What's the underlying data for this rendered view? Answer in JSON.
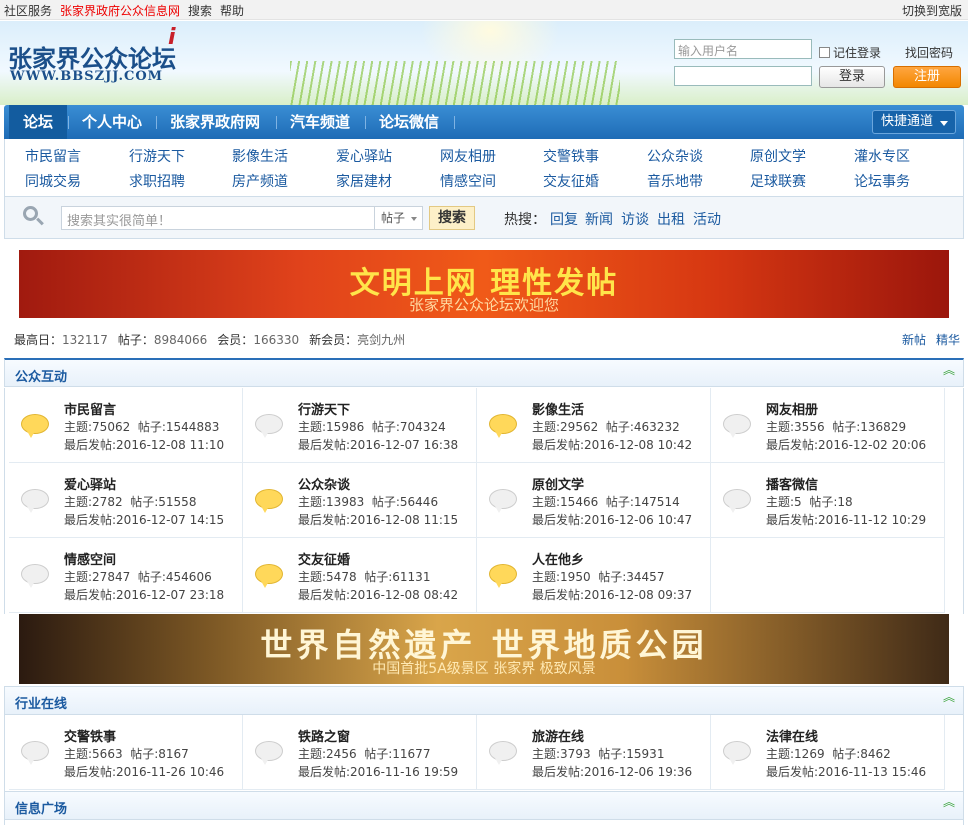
{
  "topbar": {
    "links": [
      "社区服务",
      "张家界政府公众信息网",
      "搜索",
      "帮助"
    ],
    "wide_toggle": "切换到宽版"
  },
  "header": {
    "logo_cn": "张家界公众论坛",
    "logo_en": "WWW.BBSZJJ.COM",
    "username_placeholder": "输入用户名",
    "remember_label": "记住登录",
    "recover_label": "找回密码",
    "login_label": "登录",
    "register_label": "注册"
  },
  "nav": {
    "items": [
      "论坛",
      "个人中心",
      "张家界政府网",
      "汽车频道",
      "论坛微信"
    ],
    "quick_label": "快捷通道"
  },
  "subnav": {
    "row1": [
      "市民留言",
      "行游天下",
      "影像生活",
      "爱心驿站",
      "网友相册",
      "交警铁事",
      "公众杂谈",
      "原创文学",
      "灌水专区"
    ],
    "row2": [
      "同城交易",
      "求职招聘",
      "房产频道",
      "家居建材",
      "情感空间",
      "交友征婚",
      "音乐地带",
      "足球联赛",
      "论坛事务"
    ]
  },
  "search": {
    "placeholder": "搜索其实很简单！",
    "type_label": "帖子",
    "button_label": "搜索",
    "hot_label": "热搜：",
    "hot_words": [
      "回复",
      "新闻",
      "访谈",
      "出租",
      "活动"
    ]
  },
  "banner1": {
    "title": "文明上网 理性发帖",
    "subtitle": "张家界公众论坛欢迎您"
  },
  "stats": {
    "peak_label": "最高日：",
    "peak_value": "132117",
    "posts_label": "帖子：",
    "posts_value": "8984066",
    "members_label": "会员：",
    "members_value": "166330",
    "newmember_label": "新会员：",
    "newmember_value": "亮剑九州",
    "new_posts": "新帖",
    "digest": "精华"
  },
  "sections": [
    {
      "title": "公众互动",
      "forums": [
        {
          "name": "市民留言",
          "topics": "主题:75062",
          "posts": "帖子:1544883",
          "last": "最后发帖:2016-12-08 11:10",
          "new": true
        },
        {
          "name": "行游天下",
          "topics": "主题:15986",
          "posts": "帖子:704324",
          "last": "最后发帖:2016-12-07 16:38",
          "new": false
        },
        {
          "name": "影像生活",
          "topics": "主题:29562",
          "posts": "帖子:463232",
          "last": "最后发帖:2016-12-08 10:42",
          "new": true
        },
        {
          "name": "网友相册",
          "topics": "主题:3556",
          "posts": "帖子:136829",
          "last": "最后发帖:2016-12-02 20:06",
          "new": false
        },
        {
          "name": "爱心驿站",
          "topics": "主题:2782",
          "posts": "帖子:51558",
          "last": "最后发帖:2016-12-07 14:15",
          "new": false
        },
        {
          "name": "公众杂谈",
          "topics": "主题:13983",
          "posts": "帖子:56446",
          "last": "最后发帖:2016-12-08 11:15",
          "new": true
        },
        {
          "name": "原创文学",
          "topics": "主题:15466",
          "posts": "帖子:147514",
          "last": "最后发帖:2016-12-06 10:47",
          "new": false
        },
        {
          "name": "播客微信",
          "topics": "主题:5",
          "posts": "帖子:18",
          "last": "最后发帖:2016-11-12 10:29",
          "new": false
        },
        {
          "name": "情感空间",
          "topics": "主题:27847",
          "posts": "帖子:454606",
          "last": "最后发帖:2016-12-07 23:18",
          "new": false
        },
        {
          "name": "交友征婚",
          "topics": "主题:5478",
          "posts": "帖子:61131",
          "last": "最后发帖:2016-12-08 08:42",
          "new": true
        },
        {
          "name": "人在他乡",
          "topics": "主题:1950",
          "posts": "帖子:34457",
          "last": "最后发帖:2016-12-08 09:37",
          "new": true
        }
      ]
    },
    {
      "title": "行业在线",
      "forums": [
        {
          "name": "交警铁事",
          "topics": "主题:5663",
          "posts": "帖子:8167",
          "last": "最后发帖:2016-11-26 10:46",
          "new": false
        },
        {
          "name": "铁路之窗",
          "topics": "主题:2456",
          "posts": "帖子:11677",
          "last": "最后发帖:2016-11-16 19:59",
          "new": false
        },
        {
          "name": "旅游在线",
          "topics": "主题:3793",
          "posts": "帖子:15931",
          "last": "最后发帖:2016-12-06 19:36",
          "new": false
        },
        {
          "name": "法律在线",
          "topics": "主题:1269",
          "posts": "帖子:8462",
          "last": "最后发帖:2016-11-13 15:46",
          "new": false
        }
      ]
    },
    {
      "title": "信息广场",
      "forums": []
    }
  ],
  "banner2": {
    "title": "世界自然遗产 世界地质公园",
    "subtitle": "中国首批5A级景区 张家界 极致风景"
  },
  "colors": {
    "nav_blue": "#1e6cb6",
    "link_blue": "#1b5aa0",
    "register_orange": "#f28700",
    "red_link": "#ee0000"
  }
}
